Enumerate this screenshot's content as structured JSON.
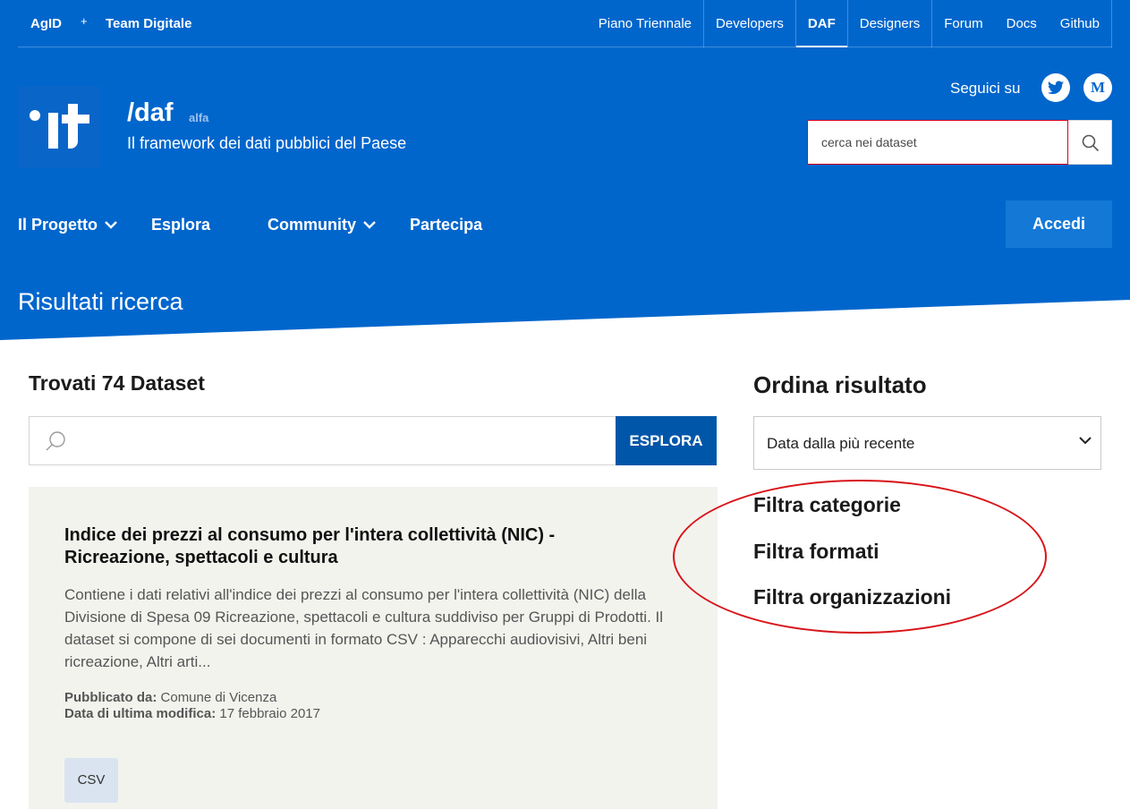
{
  "topbar": {
    "brand": "AgID",
    "plus": "+",
    "brand2": "Team Digitale",
    "links": [
      "Piano Triennale",
      "Developers",
      "DAF",
      "Designers",
      "Forum",
      "Docs",
      "Github"
    ]
  },
  "site": {
    "title": "/daf",
    "badge": "alfa",
    "subtitle": "Il framework dei dati pubblici del Paese",
    "follow_label": "Seguici su",
    "search_placeholder": "cerca nei dataset",
    "medium_letter": "M"
  },
  "nav": {
    "items": [
      "Il Progetto",
      "Esplora",
      "Community",
      "Partecipa"
    ],
    "login": "Accedi"
  },
  "page": {
    "heading": "Risultati ricerca",
    "found": "Trovati 74 Dataset",
    "explore_button": "ESPLORA"
  },
  "result": {
    "title": "Indice dei prezzi al consumo per l'intera collettività (NIC) - Ricreazione, spettacoli e cultura",
    "description": "Contiene i dati relativi all'indice dei prezzi al consumo per l'intera collettività (NIC) della Divisione di Spesa 09 Ricreazione, spettacoli e cultura suddiviso per Gruppi di Prodotti. Il dataset si compone di sei documenti in formato CSV : Apparecchi audiovisivi, Altri beni ricreazione, Altri arti...",
    "published_label": "Pubblicato da:",
    "published_value": "Comune di Vicenza",
    "modified_label": "Data di ultima modifica:",
    "modified_value": "17 febbraio 2017",
    "format_tag": "CSV"
  },
  "sidebar": {
    "sort_title": "Ordina risultato",
    "sort_value": "Data dalla più recente",
    "filters": [
      "Filtra categorie",
      "Filtra formati",
      "Filtra organizzazioni"
    ]
  },
  "colors": {
    "header_blue": "#0066cc",
    "annotation_red": "#d8141a"
  }
}
